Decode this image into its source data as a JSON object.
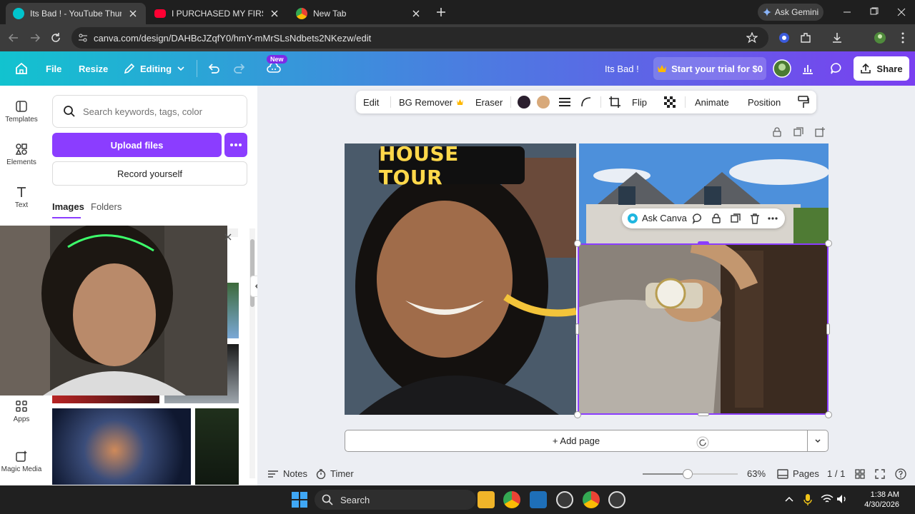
{
  "browser": {
    "tabs": [
      {
        "title": "Its Bad ! - YouTube Thumbnail",
        "favicon": "canva-icon",
        "active": true
      },
      {
        "title": "I PURCHASED MY FIRST HOUSE",
        "favicon": "youtube-icon",
        "active": false
      },
      {
        "title": "New Tab",
        "favicon": "chrome-icon",
        "active": false
      }
    ],
    "gemini_label": "Ask Gemini",
    "url": "canva.com/design/DAHBcJZqfY0/hmY-mMrSLsNdbets2NKezw/edit"
  },
  "header": {
    "file": "File",
    "resize": "Resize",
    "editing": "Editing",
    "new_badge": "New",
    "design_title": "Its Bad !",
    "trial_label": "Start your trial for $0",
    "share_label": "Share"
  },
  "rail": {
    "items": [
      {
        "label": "Templates",
        "icon": "templates-icon"
      },
      {
        "label": "Elements",
        "icon": "elements-icon"
      },
      {
        "label": "Text",
        "icon": "text-icon"
      },
      {
        "label": "Apps",
        "icon": "apps-icon"
      },
      {
        "label": "Magic Media",
        "icon": "magic-media-icon"
      }
    ]
  },
  "panel": {
    "search_placeholder": "Search keywords, tags, color",
    "upload_label": "Upload files",
    "record_label": "Record yourself",
    "tabs": [
      "Images",
      "Folders"
    ]
  },
  "context_toolbar": {
    "edit": "Edit",
    "bg_remover": "BG Remover",
    "eraser": "Eraser",
    "flip": "Flip",
    "animate": "Animate",
    "position": "Position",
    "colors": [
      "#2b1f2e",
      "#d8a97a"
    ]
  },
  "canvas": {
    "banner_text": "HOUSE TOUR",
    "ask_canva": "Ask Canva",
    "add_page": "+ Add page"
  },
  "footer": {
    "notes": "Notes",
    "timer": "Timer",
    "zoom": "63%",
    "zoom_fraction": 0.47,
    "pages_label": "Pages",
    "page_count": "1 / 1"
  },
  "taskbar": {
    "search": "Search",
    "time": "1:38 AM",
    "date": "4/30/2026"
  }
}
